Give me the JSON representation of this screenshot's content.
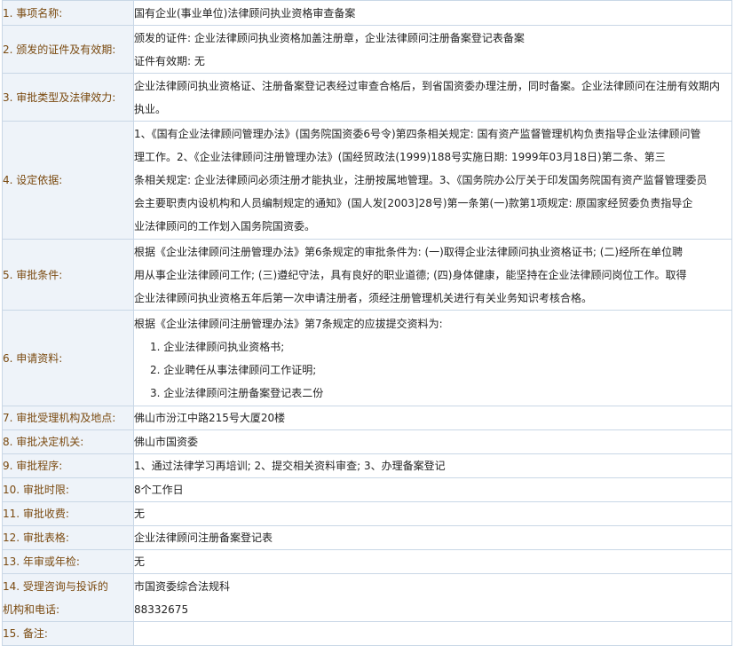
{
  "rows": [
    {
      "label": "1. 事项名称:",
      "lines": [
        "国有企业(事业单位)法律顾问执业资格审查备案"
      ]
    },
    {
      "label": "2. 颁发的证件及有效期:",
      "lines": [
        "颁发的证件:  企业法律顾问执业资格加盖注册章，企业法律顾问注册备案登记表备案",
        "证件有效期:  无"
      ]
    },
    {
      "label": "3. 审批类型及法律效力:",
      "lines": [
        "企业法律顾问执业资格证、注册备案登记表经过审查合格后，到省国资委办理注册，同时备案。企业法律顾问在注册有效期内",
        "执业。"
      ]
    },
    {
      "label": "4. 设定依据:",
      "lines": [
        "1、《国有企业法律顾问管理办法》(国务院国资委6号令)第四条相关规定: 国有资产监督管理机构负责指导企业法律顾问管",
        "理工作。2、《企业法律顾问注册管理办法》(国经贸政法(1999)188号实施日期: 1999年03月18日)第二条、第三",
        "条相关规定: 企业法律顾问必须注册才能执业，注册按属地管理。3、《国务院办公厅关于印发国务院国有资产监督管理委员",
        "会主要职责内设机构和人员编制规定的通知》(国人发[2003]28号)第一条第(一)款第1项规定: 原国家经贸委负责指导企",
        "业法律顾问的工作划入国务院国资委。"
      ]
    },
    {
      "label": "5. 审批条件:",
      "lines": [
        "根据《企业法律顾问注册管理办法》第6条规定的审批条件为: (一)取得企业法律顾问执业资格证书; (二)经所在单位聘",
        "用从事企业法律顾问工作; (三)遵纪守法，具有良好的职业道德; (四)身体健康，能坚持在企业法律顾问岗位工作。取得",
        "企业法律顾问执业资格五年后第一次申请注册者，须经注册管理机关进行有关业务知识考核合格。"
      ]
    },
    {
      "label": "6. 申请资料:",
      "lines": [
        "根据《企业法律顾问注册管理办法》第7条规定的应拔提交资料为:"
      ],
      "items": [
        "1. 企业法律顾问执业资格书;",
        "2. 企业聘任从事法律顾问工作证明;",
        "3. 企业法律顾问注册备案登记表二份"
      ]
    },
    {
      "label": "7. 审批受理机构及地点:",
      "lines": [
        "佛山市汾江中路215号大厦20楼"
      ]
    },
    {
      "label": "8. 审批决定机关:",
      "lines": [
        "佛山市国资委"
      ]
    },
    {
      "label": "9. 审批程序:",
      "lines": [
        "1、通过法律学习再培训; 2、提交相关资料审查; 3、办理备案登记"
      ]
    },
    {
      "label": "10. 审批时限:",
      "lines": [
        "8个工作日"
      ]
    },
    {
      "label": "11. 审批收费:",
      "lines": [
        "无"
      ]
    },
    {
      "label": "12. 审批表格:",
      "lines": [
        "企业法律顾问注册备案登记表"
      ]
    },
    {
      "label": "13. 年审或年检:",
      "lines": [
        "无"
      ]
    },
    {
      "label": "14. 受理咨询与投诉的机构和电话:",
      "labelLines": [
        "14. 受理咨询与投诉的",
        "机构和电话:"
      ],
      "lines": [
        "市国资委综合法规科",
        "88332675"
      ]
    },
    {
      "label": "15. 备注:",
      "lines": []
    }
  ]
}
